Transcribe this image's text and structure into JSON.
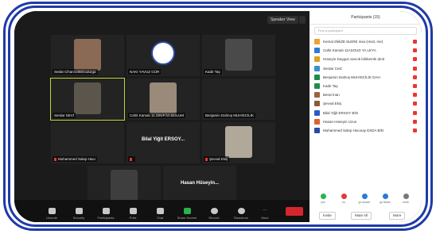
{
  "video": {
    "view_button": "Speaker View",
    "tiles": [
      {
        "name": "Sedat Cihan/10B/Dodurga",
        "type": "video"
      },
      {
        "name": "NAKI YAVUZ GÜR",
        "type": "logo"
      },
      {
        "name": "Kadir Taş",
        "type": "video"
      },
      {
        "name": "Serdar SEVİ",
        "type": "video"
      },
      {
        "name": "Cahit Kamalı 11.SINIF/10.BOLUM",
        "type": "video"
      },
      {
        "name": "Benjamin Dalmış MUHİSCİLİK",
        "type": "dark"
      },
      {
        "name": "Muhammed Sakıp Hacı",
        "type": "dark"
      },
      {
        "name": "",
        "big": "Bilal Yiğit ERSOY...",
        "type": "text"
      },
      {
        "name": "Şevval Ekiş",
        "type": "video"
      },
      {
        "name": "Berat İnan",
        "type": "video"
      },
      {
        "name": "",
        "big": "Hasan Hüseyin...",
        "type": "text"
      }
    ],
    "toolbar": [
      {
        "label": "Unmute",
        "icon": "mic-icon"
      },
      {
        "label": "Security",
        "icon": "shield-icon"
      },
      {
        "label": "Participants",
        "icon": "people-icon"
      },
      {
        "label": "Polls",
        "icon": "bar-chart-icon"
      },
      {
        "label": "Chat",
        "icon": "chat-icon"
      },
      {
        "label": "Share Screen",
        "icon": "share-icon"
      },
      {
        "label": "Record",
        "icon": "record-icon"
      },
      {
        "label": "Reactions",
        "icon": "emoji-icon"
      },
      {
        "label": "More",
        "icon": "more-icon"
      }
    ],
    "end_label": "End"
  },
  "panel": {
    "title": "Participants (15)",
    "search_placeholder": "Find a participant",
    "participants": [
      {
        "name": "Kemal öfeliZE 9LERE insa (Host, me)",
        "color": "#f0a030"
      },
      {
        "name": "Cahit Kamalı 11ASOUD YA LEYA",
        "color": "#2a7bd6"
      },
      {
        "name": "Hüseyin Duygun sevcık bilrikemhi dmit",
        "color": "#e0a020"
      },
      {
        "name": "Serdar Cetz",
        "color": "#3a8ed8"
      },
      {
        "name": "Benjamin Dalmış MUHİSCİLİK DAH",
        "color": "#1e8c4a"
      },
      {
        "name": "Kadir Taş",
        "color": "#1e8c4a"
      },
      {
        "name": "Berat İnan",
        "color": "#a06040"
      },
      {
        "name": "Şevval Ekiş",
        "color": "#8a5a3a"
      },
      {
        "name": "Bilal Yiğit ERSOY BİN",
        "color": "#2a5bc6"
      },
      {
        "name": "Hasan Hüseyin Uzun",
        "color": "#e06030"
      },
      {
        "name": "Muhammed Sakıp Hacısay ESDA BİN",
        "color": "#2a4aa6"
      }
    ],
    "reactions": [
      {
        "label": "yes",
        "color": "#2bb24c"
      },
      {
        "label": "no",
        "color": "#e33a3a"
      },
      {
        "label": "go slower",
        "color": "#2a7bd6"
      },
      {
        "label": "go faster",
        "color": "#2a7bd6"
      },
      {
        "label": "more",
        "color": "#777777"
      }
    ],
    "buttons": [
      "Invite",
      "Mute All",
      "More"
    ]
  }
}
